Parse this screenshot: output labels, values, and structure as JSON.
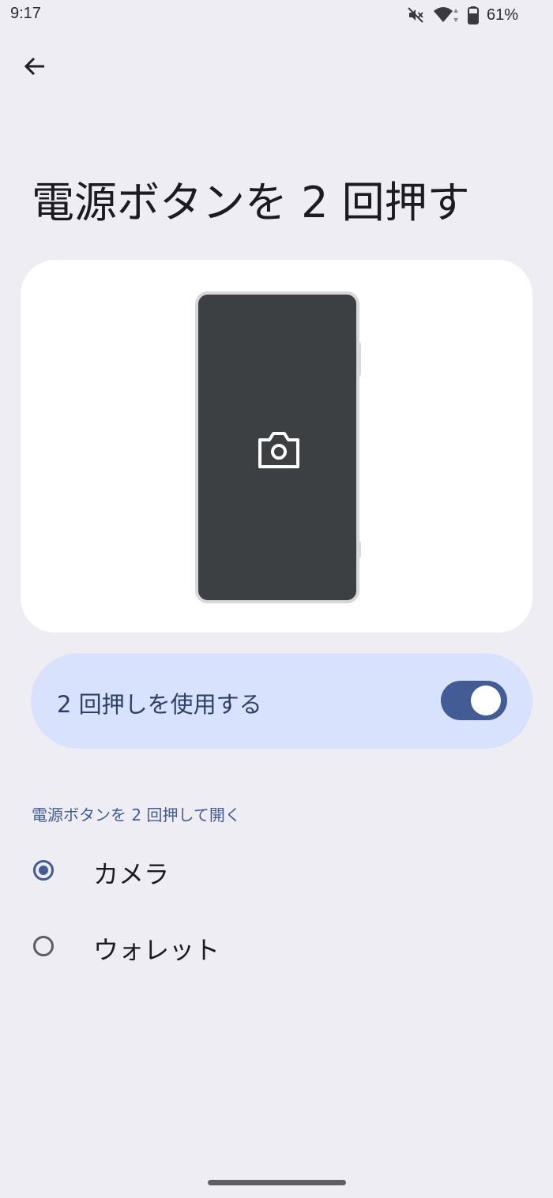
{
  "status_bar": {
    "time": "9:17",
    "battery_percent": "61%",
    "icons": [
      "mute-icon",
      "wifi-icon",
      "battery-icon"
    ]
  },
  "header": {
    "back_icon": "arrow-back-icon"
  },
  "page": {
    "title": "電源ボタンを 2 回押す"
  },
  "illustration": {
    "icon": "camera-icon"
  },
  "toggle": {
    "label": "2 回押しを使用する",
    "enabled": true
  },
  "options_section": {
    "header": "電源ボタンを 2 回押して開く",
    "options": [
      {
        "label": "カメラ",
        "selected": true
      },
      {
        "label": "ウォレット",
        "selected": false
      }
    ]
  },
  "colors": {
    "background": "#EEEDF3",
    "accent": "#445C95",
    "toggle_row_bg": "#D8E2FD",
    "card_bg": "#FFFFFF",
    "phone_screen": "#3C4043"
  }
}
